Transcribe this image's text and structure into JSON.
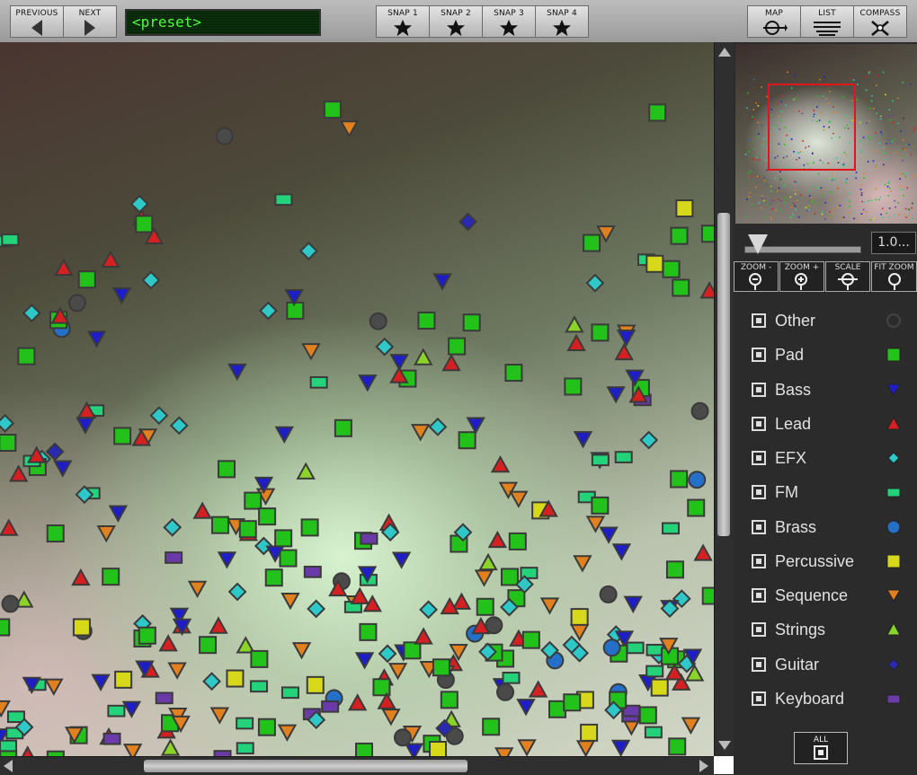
{
  "toolbar": {
    "previous_label": "PREVIOUS",
    "next_label": "NEXT",
    "preset_text": "<preset>",
    "snaps": [
      "SNAP 1",
      "SNAP 2",
      "SNAP 3",
      "SNAP 4"
    ],
    "map_label": "MAP",
    "list_label": "LIST",
    "compass_label": "COMPASS"
  },
  "zoom": {
    "value": "1.0...",
    "buttons": [
      "ZOOM -",
      "ZOOM +",
      "SCALE",
      "FIT ZOOM"
    ]
  },
  "legend": [
    {
      "label": "Other",
      "shape": "circle-outline",
      "color": "#3a3a3a"
    },
    {
      "label": "Pad",
      "shape": "square",
      "color": "#22c21a"
    },
    {
      "label": "Bass",
      "shape": "triangle-down",
      "color": "#1e1ec8"
    },
    {
      "label": "Lead",
      "shape": "triangle-up",
      "color": "#d42020"
    },
    {
      "label": "EFX",
      "shape": "diamond",
      "color": "#2ec8c8"
    },
    {
      "label": "FM",
      "shape": "rect",
      "color": "#24d27a"
    },
    {
      "label": "Brass",
      "shape": "circle",
      "color": "#2470c8"
    },
    {
      "label": "Percussive",
      "shape": "square",
      "color": "#d8d81a"
    },
    {
      "label": "Sequence",
      "shape": "triangle-down",
      "color": "#e0801e"
    },
    {
      "label": "Strings",
      "shape": "triangle-up",
      "color": "#8ad42a"
    },
    {
      "label": "Guitar",
      "shape": "diamond",
      "color": "#2a2ab0"
    },
    {
      "label": "Keyboard",
      "shape": "rect",
      "color": "#6a3aa8"
    }
  ],
  "all_label": "ALL"
}
